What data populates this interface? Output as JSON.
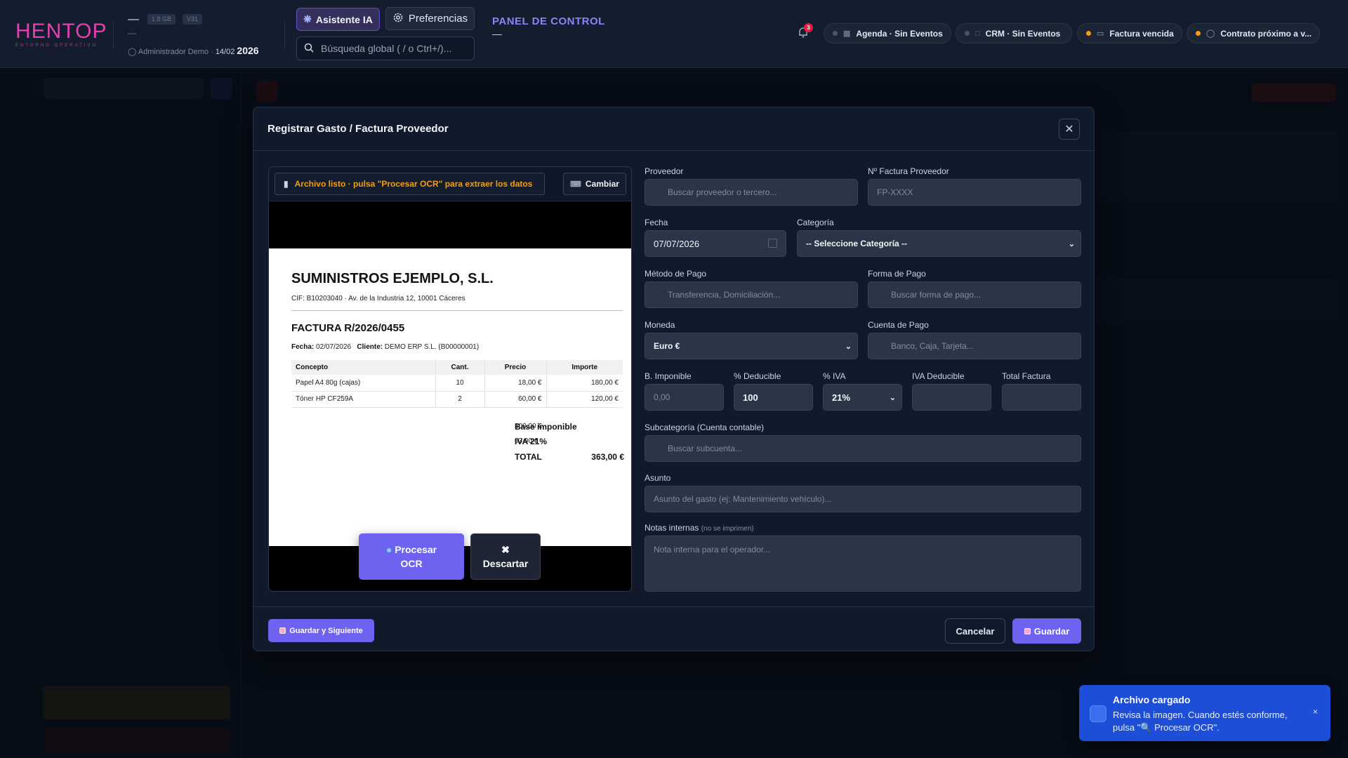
{
  "header": {
    "logo_text": "HENTOP",
    "logo_sub": "ENTORNO OPERATIVO",
    "workspace_dash": "—",
    "storage_badge": "1.8 GB",
    "version_badge": "V31",
    "workspace_dash2": "—",
    "user": "Administrador Demo",
    "date": "14/02",
    "year": "2026",
    "ia_button": "Asistente IA",
    "prefs_button": "Preferencias",
    "search_placeholder": "Búsqueda global ( / o Ctrl+/)...",
    "panel_title": "PANEL DE CONTROL",
    "panel_sub": "—",
    "notif_count": "3",
    "pills": [
      {
        "label": "Agenda · Sin Eventos",
        "status": "gray"
      },
      {
        "label": "CRM · Sin Eventos",
        "status": "gray"
      },
      {
        "label": "Factura vencida",
        "status": "orange"
      },
      {
        "label": "Contrato próximo a v...",
        "status": "orange"
      }
    ]
  },
  "modal": {
    "title": "Registrar Gasto / Factura Proveedor",
    "preview": {
      "status": "Archivo listo · pulsa \"Procesar OCR\" para extraer los datos",
      "change_button": "Cambiar",
      "ocr_button_l1": "Procesar",
      "ocr_button_l2": "OCR",
      "discard_button": "Descartar"
    },
    "invoice": {
      "company": "SUMINISTROS EJEMPLO, S.L.",
      "cif_line": "CIF: B10203040 · Av. de la Industria 12, 10001 Cáceres",
      "number": "FACTURA R/2026/0455",
      "date_label": "Fecha:",
      "date_value": "02/07/2026",
      "client_label": "Cliente:",
      "client_value": "DEMO ERP S.L. (B00000001)",
      "columns": [
        "Concepto",
        "Cant.",
        "Precio",
        "Importe"
      ],
      "rows": [
        [
          "Papel A4 80g (cajas)",
          "10",
          "18,00 €",
          "180,00 €"
        ],
        [
          "Tóner HP CF259A",
          "2",
          "60,00 €",
          "120,00 €"
        ]
      ],
      "base_label": "Base imponible",
      "base_value": "300,00 €",
      "iva_label": "IVA 21%",
      "iva_value": "63,00 €",
      "total_label": "TOTAL",
      "total_value": "363,00 €"
    },
    "form": {
      "proveedor_label": "Proveedor",
      "proveedor_placeholder": "Buscar proveedor o tercero...",
      "nfactura_label": "Nº Factura Proveedor",
      "nfactura_placeholder": "FP-XXXX",
      "fecha_label": "Fecha",
      "fecha_value": "07/07/2026",
      "categoria_label": "Categoría",
      "categoria_value": "-- Seleccione Categoría --",
      "metodo_label": "Método de Pago",
      "metodo_placeholder": "Transferencia, Domiciliación...",
      "forma_label": "Forma de Pago",
      "forma_placeholder": "Buscar forma de pago...",
      "moneda_label": "Moneda",
      "moneda_value": "Euro €",
      "cuenta_label": "Cuenta de Pago",
      "cuenta_placeholder": "Banco, Caja, Tarjeta...",
      "base_label": "B. Imponible",
      "base_placeholder": "0,00",
      "deducible_label": "% Deducible",
      "deducible_value": "100",
      "iva_label": "% IVA",
      "iva_value": "21%",
      "iva_deducible_label": "IVA Deducible",
      "iva_deducible_value": "",
      "total_label": "Total Factura",
      "total_value": "",
      "subcat_label": "Subcategoría (Cuenta contable)",
      "subcat_placeholder": "Buscar subcuenta...",
      "asunto_label": "Asunto",
      "asunto_placeholder": "Asunto del gasto (ej: Mantenimiento vehículo)...",
      "notas_label": "Notas internas",
      "notas_hint": "(no se imprimen)",
      "notas_placeholder": "Nota interna para el operador..."
    },
    "footer": {
      "save_next": "Guardar y Siguiente",
      "cancel": "Cancelar",
      "save": "Guardar"
    }
  },
  "toast": {
    "title": "Archivo cargado",
    "body": "Revisa la imagen. Cuando estés conforme, pulsa \"🔍 Procesar OCR\".",
    "close": "×"
  },
  "colors": {
    "accent": "#6d63f0",
    "warning": "#f59e0b",
    "toast": "#1d4ed8",
    "brand": "#e040b0"
  }
}
